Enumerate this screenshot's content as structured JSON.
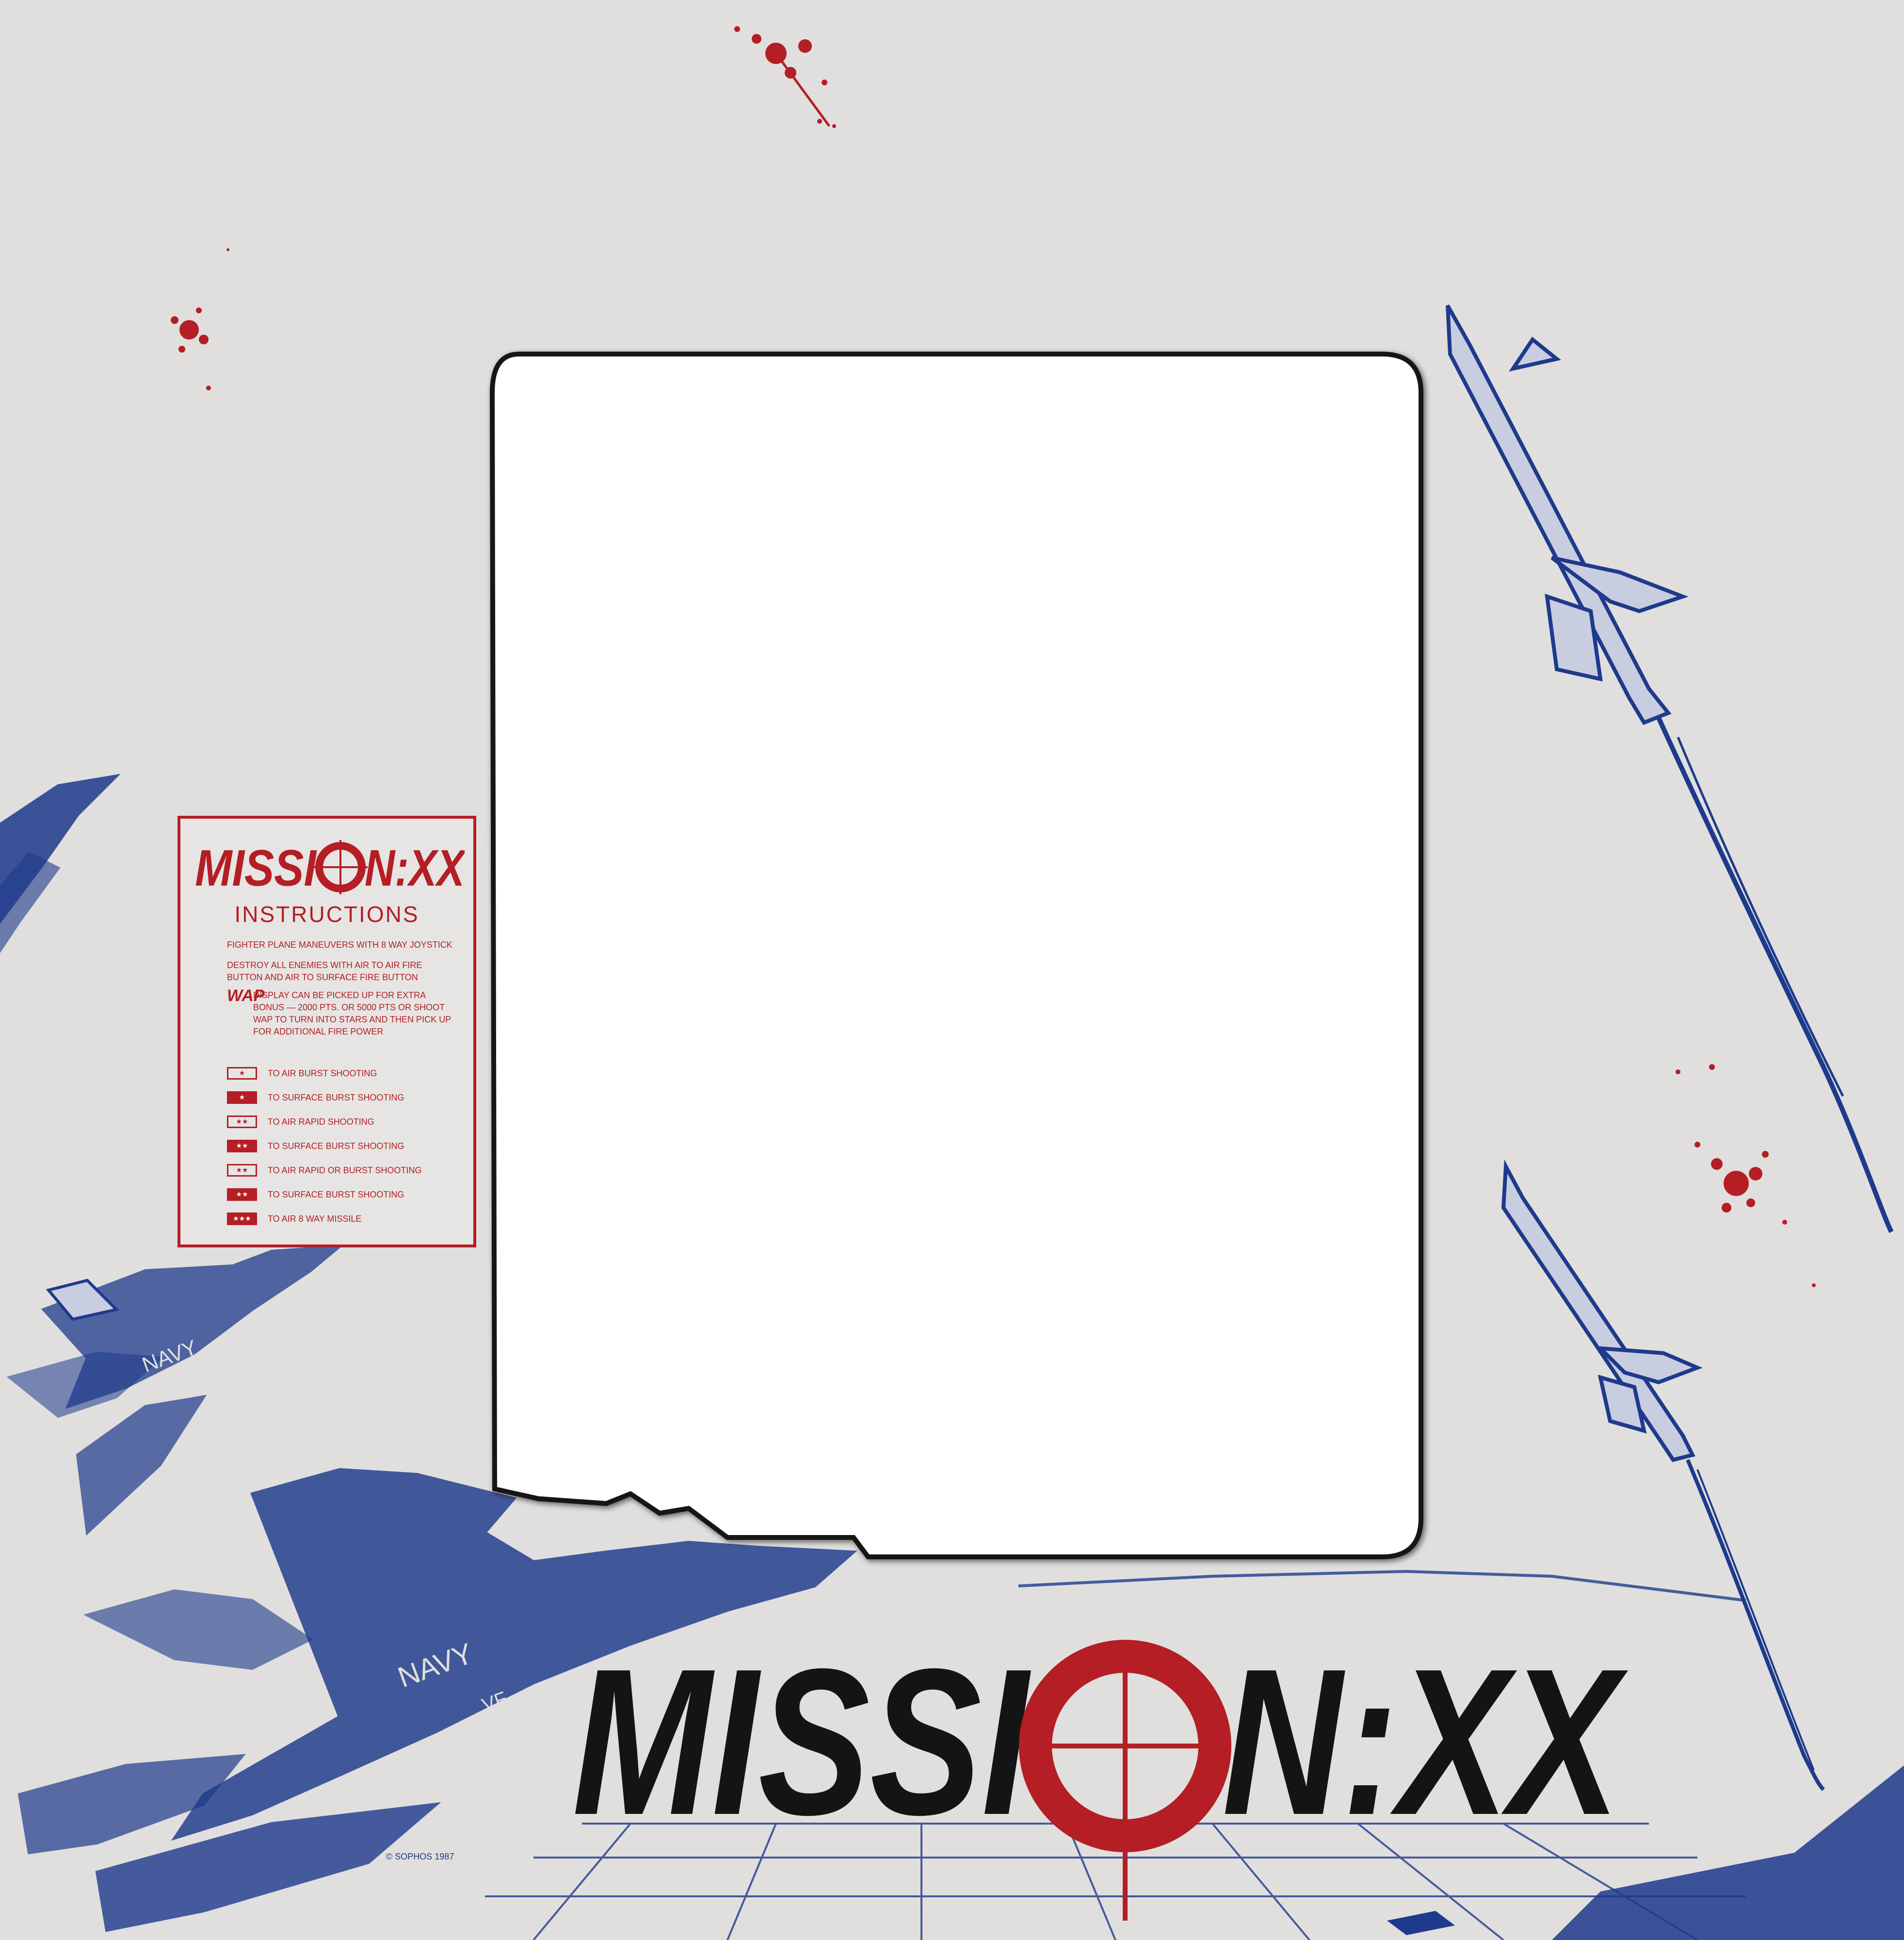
{
  "colors": {
    "background": "#e0dfdd",
    "navy_blue": "#1e3a8c",
    "accent_red": "#b41e24",
    "logo_black": "#141414",
    "screen_white": "#ffffff"
  },
  "logo": {
    "text_left": "MISSI",
    "text_right": "N:XX",
    "crosshair_icon": "crosshair-target-o"
  },
  "instructions": {
    "logo_text_left": "MISSI",
    "logo_text_right": "N:XX",
    "title": "INSTRUCTIONS",
    "line1": "FIGHTER PLANE MANEUVERS WITH 8 WAY JOYSTICK",
    "line2": "DESTROY ALL ENEMIES WITH AIR TO AIR FIRE BUTTON AND AIR TO SURFACE FIRE BUTTON",
    "wap_label": "WAP",
    "wap_text": "DISPLAY CAN BE PICKED UP FOR EXTRA BONUS — 2000 PTS. OR 5000 PTS OR SHOOT WAP TO TURN INTO STARS AND THEN PICK UP FOR ADDITIONAL FIRE POWER",
    "legend": [
      {
        "stars": "★",
        "filled": false,
        "label": "TO AIR BURST SHOOTING"
      },
      {
        "stars": "★",
        "filled": true,
        "label": "TO SURFACE BURST SHOOTING"
      },
      {
        "stars": "★★",
        "filled": false,
        "label": "TO AIR RAPID SHOOTING"
      },
      {
        "stars": "★★",
        "filled": true,
        "label": "TO SURFACE BURST SHOOTING"
      },
      {
        "stars": "★★",
        "filled": false,
        "label": "TO AIR RAPID OR BURST SHOOTING"
      },
      {
        "stars": "★★",
        "filled": true,
        "label": "TO SURFACE BURST SHOOTING"
      },
      {
        "stars": "★★★",
        "filled": true,
        "label": "TO AIR 8 WAY MISSILE"
      }
    ]
  },
  "artwork": {
    "jet_markings": [
      "NAVY",
      "NAVY",
      "VF"
    ],
    "elements": [
      "fighter-jet",
      "missile",
      "explosion-splatter",
      "runway-grid"
    ]
  },
  "copyright": "© SOPHOS 1987"
}
